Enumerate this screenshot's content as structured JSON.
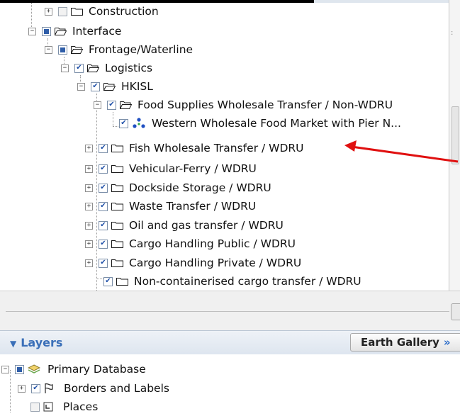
{
  "tree": {
    "items": [
      {
        "label": "Construction",
        "expander": "+",
        "check": "empty",
        "icon": "folder"
      },
      {
        "label": "Interface",
        "expander": "-",
        "check": "partial",
        "icon": "folder-open"
      },
      {
        "label": "Frontage/Waterline",
        "expander": "-",
        "check": "partial",
        "icon": "folder-open"
      },
      {
        "label": "Logistics",
        "expander": "-",
        "check": "checked",
        "icon": "folder-open"
      },
      {
        "label": "HKISL",
        "expander": "-",
        "check": "checked",
        "icon": "folder-open"
      },
      {
        "label": "Food Supplies Wholesale Transfer / Non-WDRU",
        "expander": "-",
        "check": "checked",
        "icon": "folder-open"
      },
      {
        "label": "Western Wholesale Food Market with Pier N...",
        "expander": "",
        "check": "checked",
        "icon": "network"
      },
      {
        "label": "Fish Wholesale Transfer / WDRU",
        "expander": "+",
        "check": "checked",
        "icon": "folder"
      },
      {
        "label": "Vehicular-Ferry / WDRU",
        "expander": "+",
        "check": "checked",
        "icon": "folder"
      },
      {
        "label": "Dockside Storage / WDRU",
        "expander": "+",
        "check": "checked",
        "icon": "folder"
      },
      {
        "label": "Waste Transfer / WDRU",
        "expander": "+",
        "check": "checked",
        "icon": "folder"
      },
      {
        "label": "Oil and gas transfer / WDRU",
        "expander": "+",
        "check": "checked",
        "icon": "folder"
      },
      {
        "label": "Cargo Handling Public / WDRU",
        "expander": "+",
        "check": "checked",
        "icon": "folder"
      },
      {
        "label": "Cargo Handling Private / WDRU",
        "expander": "+",
        "check": "checked",
        "icon": "folder"
      },
      {
        "label": "Non-containerised cargo transfer / WDRU",
        "expander": "",
        "check": "checked",
        "icon": "folder"
      }
    ]
  },
  "layers": {
    "title": "Layers",
    "gallery_label": "Earth Gallery",
    "gallery_arrow": "»",
    "items": [
      {
        "label": "Primary Database",
        "expander": "-",
        "check": "partial",
        "icon": "layers-icon"
      },
      {
        "label": "Borders and Labels",
        "expander": "+",
        "check": "checked",
        "icon": "flag-icon"
      },
      {
        "label": "Places",
        "expander": "",
        "check": "empty",
        "icon": "places-icon"
      }
    ]
  },
  "colors": {
    "accent": "#3a6fb8",
    "annotation_arrow": "#e01010"
  }
}
